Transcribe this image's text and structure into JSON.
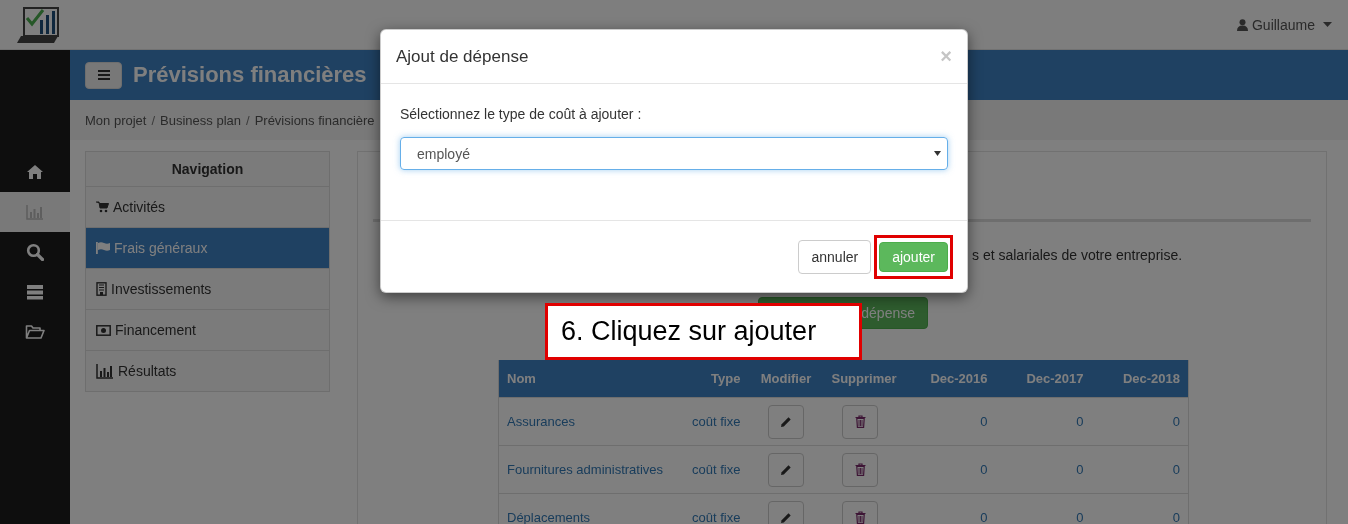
{
  "topbar": {
    "user": "Guillaume"
  },
  "sidebar": {
    "items": [
      {
        "kind": "home",
        "selected": false
      },
      {
        "kind": "chart",
        "selected": true
      },
      {
        "kind": "search",
        "selected": false
      },
      {
        "kind": "server",
        "selected": false
      },
      {
        "kind": "folder",
        "selected": false
      }
    ]
  },
  "header": {
    "title": "Prévisions financières"
  },
  "breadcrumb": {
    "separator": "/",
    "items": [
      "Mon projet",
      "Business plan",
      "Prévisions financière"
    ]
  },
  "navigation": {
    "title": "Navigation",
    "items": [
      {
        "label": "Activités",
        "kind": "cart",
        "selected": false
      },
      {
        "label": "Frais généraux",
        "kind": "flag",
        "selected": true
      },
      {
        "label": "Investissements",
        "kind": "building",
        "selected": false
      },
      {
        "label": "Financement",
        "kind": "money",
        "selected": false
      },
      {
        "label": "Résultats",
        "kind": "chart",
        "selected": false
      }
    ]
  },
  "content": {
    "description": "s et salariales de votre entreprise.",
    "add_button": "dépense",
    "table": {
      "columns": [
        "Nom",
        "Type",
        "Modifier",
        "Supprimer",
        "Dec-2016",
        "Dec-2017",
        "Dec-2018"
      ],
      "rows": [
        {
          "name": "Assurances",
          "type": "coût fixe",
          "values": [
            "0",
            "0",
            "0"
          ]
        },
        {
          "name": "Fournitures administratives",
          "type": "coût fixe",
          "values": [
            "0",
            "0",
            "0"
          ]
        },
        {
          "name": "Déplacements",
          "type": "coût fixe",
          "values": [
            "0",
            "0",
            "0"
          ]
        }
      ]
    }
  },
  "modal": {
    "title": "Ajout de dépense",
    "close": "×",
    "label": "Sélectionnez le type de coût à ajouter :",
    "select_value": "employé",
    "buttons": [
      {
        "label": "annuler",
        "kind": "default",
        "highlighted": false
      },
      {
        "label": "ajouter",
        "kind": "primary",
        "highlighted": true
      }
    ]
  },
  "callout": {
    "text": "6. Cliquez sur ajouter"
  }
}
